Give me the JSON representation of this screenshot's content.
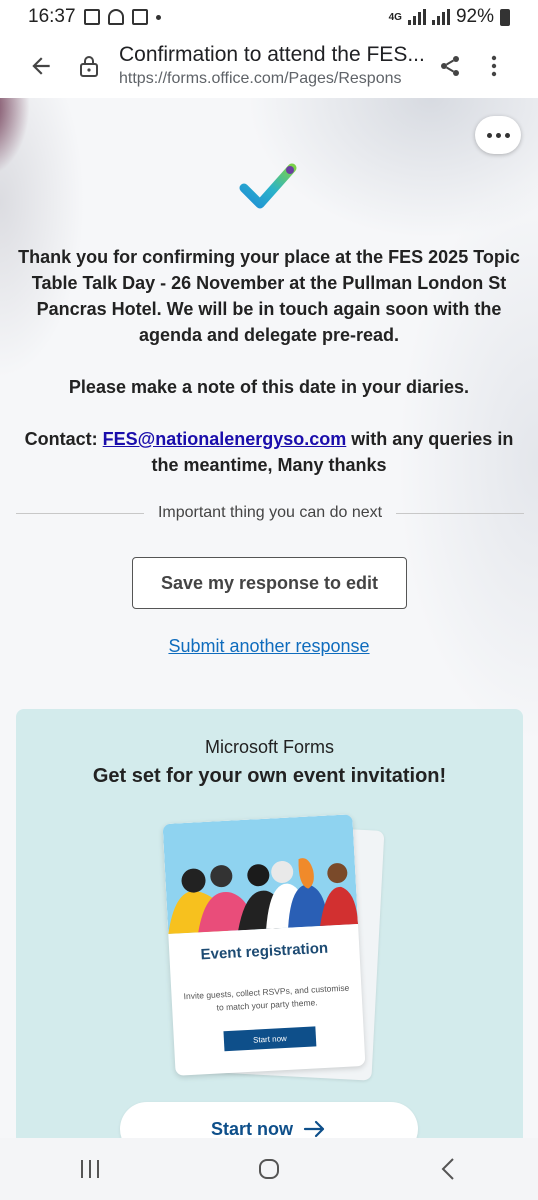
{
  "status_bar": {
    "time": "16:37",
    "network_type": "4G",
    "battery": "92%"
  },
  "app_bar": {
    "title": "Confirmation to attend the FES...",
    "url": "https://forms.office.com/Pages/Respons"
  },
  "message": {
    "paragraph1": "Thank you for confirming your place at the FES 2025 Topic Table Talk Day - 26 November at the Pullman London St Pancras Hotel. We will be in touch again soon with the agenda and delegate pre-read.",
    "paragraph2": "Please make a note of this date in your diaries.",
    "contact_prefix": "Contact: ",
    "contact_email": "FES@nationalenergyso.com",
    "contact_suffix": " with any queries in the meantime, Many thanks"
  },
  "next_steps": {
    "divider_label": "Important thing you can do next",
    "save_button": "Save my response to edit",
    "submit_another": "Submit another response"
  },
  "promo": {
    "brand": "Microsoft Forms",
    "title": "Get set for your own event invitation!",
    "card_title": "Event registration",
    "card_description": "Invite guests, collect RSVPs, and customise to match your party theme.",
    "card_button": "Start now",
    "start_button": "Start now"
  },
  "colors": {
    "link": "#1a0dab",
    "submit_link": "#0f6cbd",
    "promo_background": "#d3ebec",
    "primary_button": "#0e4f8a"
  },
  "icons": [
    "back-arrow-icon",
    "lock-icon",
    "share-icon",
    "more-vert-icon",
    "more-horiz-icon",
    "forms-check-icon",
    "arrow-right-icon",
    "recents-icon",
    "home-icon",
    "back-nav-icon"
  ]
}
